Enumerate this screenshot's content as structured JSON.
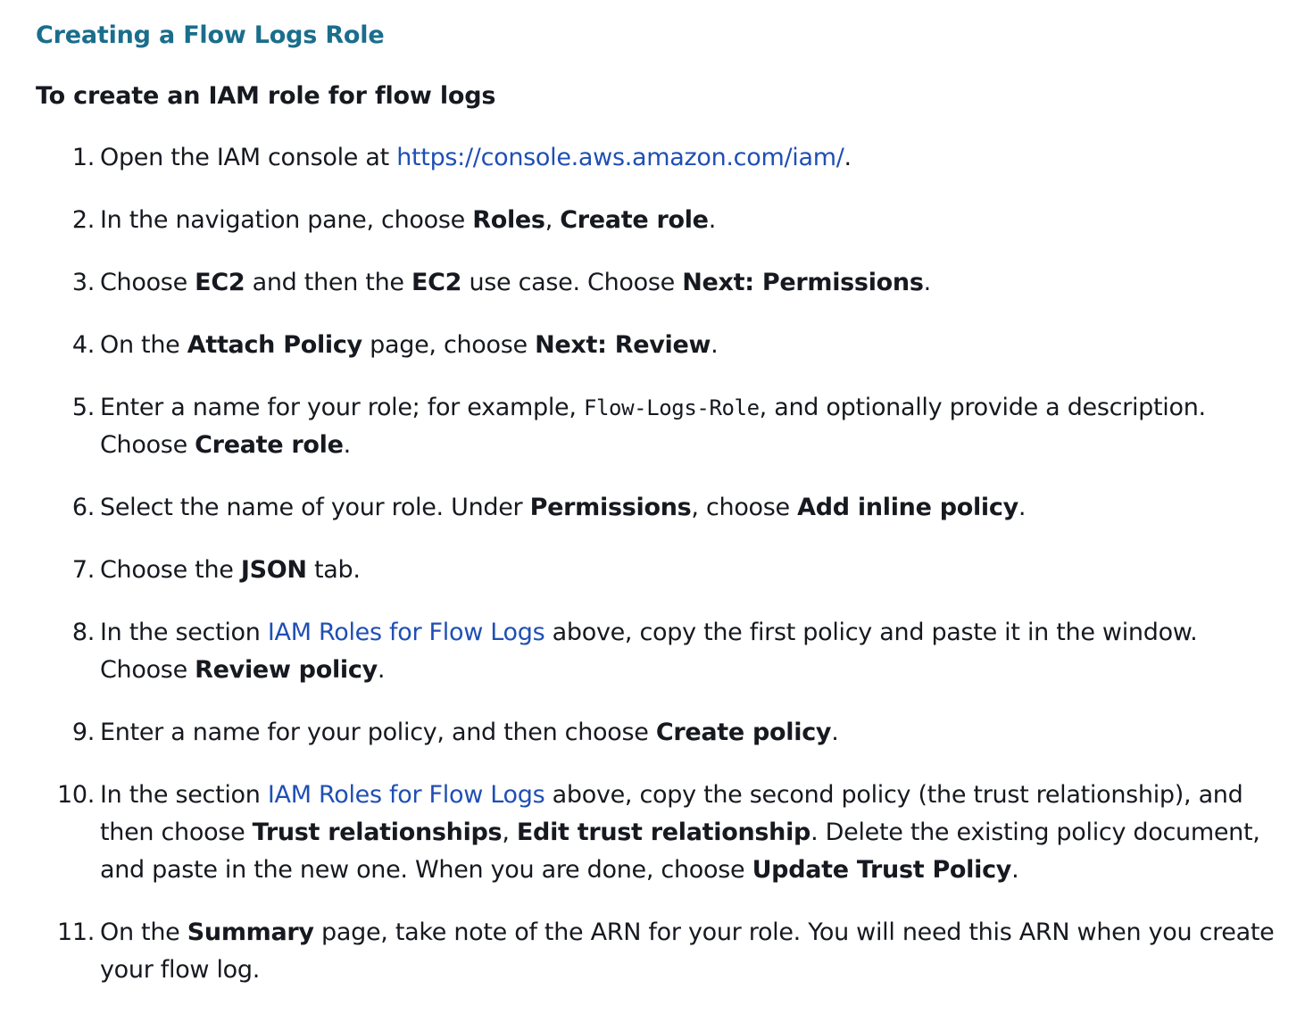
{
  "section_title": "Creating a Flow Logs Role",
  "procedure_title": "To create an IAM role for flow logs",
  "steps": [
    {
      "number": "1.",
      "parts": [
        "Open the IAM console at ",
        "https://console.aws.amazon.com/iam/",
        "."
      ]
    },
    {
      "number": "2.",
      "parts": [
        "In the navigation pane, choose ",
        "Roles",
        ", ",
        "Create role",
        "."
      ]
    },
    {
      "number": "3.",
      "parts": [
        "Choose ",
        "EC2",
        " and then the ",
        "EC2",
        " use case. Choose ",
        "Next: Permissions",
        "."
      ]
    },
    {
      "number": "4.",
      "parts": [
        "On the ",
        "Attach Policy",
        " page, choose ",
        "Next: Review",
        "."
      ]
    },
    {
      "number": "5.",
      "parts": [
        "Enter a name for your role; for example, ",
        "Flow-Logs-Role",
        ", and optionally provide a description. Choose ",
        "Create role",
        "."
      ]
    },
    {
      "number": "6.",
      "parts": [
        "Select the name of your role. Under ",
        "Permissions",
        ", choose ",
        "Add inline policy",
        "."
      ]
    },
    {
      "number": "7.",
      "parts": [
        "Choose the ",
        "JSON",
        " tab."
      ]
    },
    {
      "number": "8.",
      "parts": [
        "In the section ",
        "IAM Roles for Flow Logs",
        " above, copy the first policy and paste it in the window. Choose ",
        "Review policy",
        "."
      ]
    },
    {
      "number": "9.",
      "parts": [
        "Enter a name for your policy, and then choose ",
        "Create policy",
        "."
      ]
    },
    {
      "number": "10.",
      "parts": [
        "In the section ",
        "IAM Roles for Flow Logs",
        " above, copy the second policy (the trust relationship), and then choose ",
        "Trust relationships",
        ", ",
        "Edit trust relationship",
        ". Delete the existing policy document, and paste in the new one. When you are done, choose ",
        "Update Trust Policy",
        "."
      ]
    },
    {
      "number": "11.",
      "parts": [
        "On the ",
        "Summary",
        " page, take note of the ARN for your role. You will need this ARN when you create your flow log."
      ]
    }
  ],
  "colors": {
    "heading": "#1a6e8c",
    "text": "#16191f",
    "link": "#1f4fb4"
  }
}
